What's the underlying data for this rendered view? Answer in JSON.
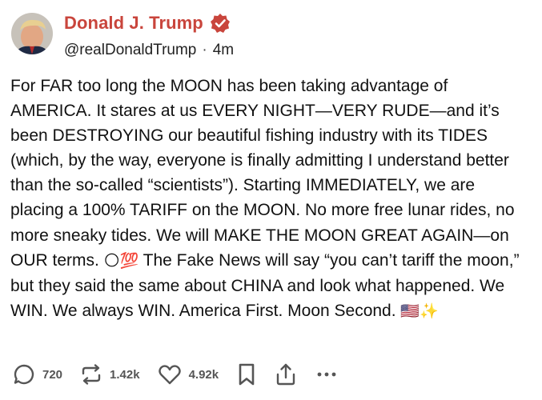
{
  "author": {
    "display_name": "Donald J. Trump",
    "handle": "@realDonaldTrump",
    "separator": "·",
    "time": "4m",
    "verified_icon": "verified-badge-icon",
    "brand_color": "#c9453c"
  },
  "post": {
    "text": "For FAR too long the MOON has been taking advantage of AMERICA. It stares at us EVERY NIGHT—VERY RUDE—and it’s been DESTROYING our beautiful fishing industry with its TIDES (which, by the way, everyone is finally admitting I understand better than the so-called “scientists”). Starting IMMEDIATELY, we are placing a 100% TARIFF on the MOON. No more free lunar rides, no more sneaky tides. We will MAKE THE MOON GREAT AGAIN—on OUR terms.",
    "emoji_1": "🌕💯",
    "text_2": " The Fake News will say “you can’t tariff the moon,” but they said the same about CHINA and look what happened. We WIN. We always WIN. America First. Moon Second. ",
    "emoji_2": "🇺🇸✨"
  },
  "actions": {
    "reply_count": "720",
    "retruth_count": "1.42k",
    "like_count": "4.92k",
    "icons": [
      "reply-icon",
      "retruth-icon",
      "like-icon",
      "bookmark-icon",
      "share-icon",
      "more-icon"
    ]
  }
}
